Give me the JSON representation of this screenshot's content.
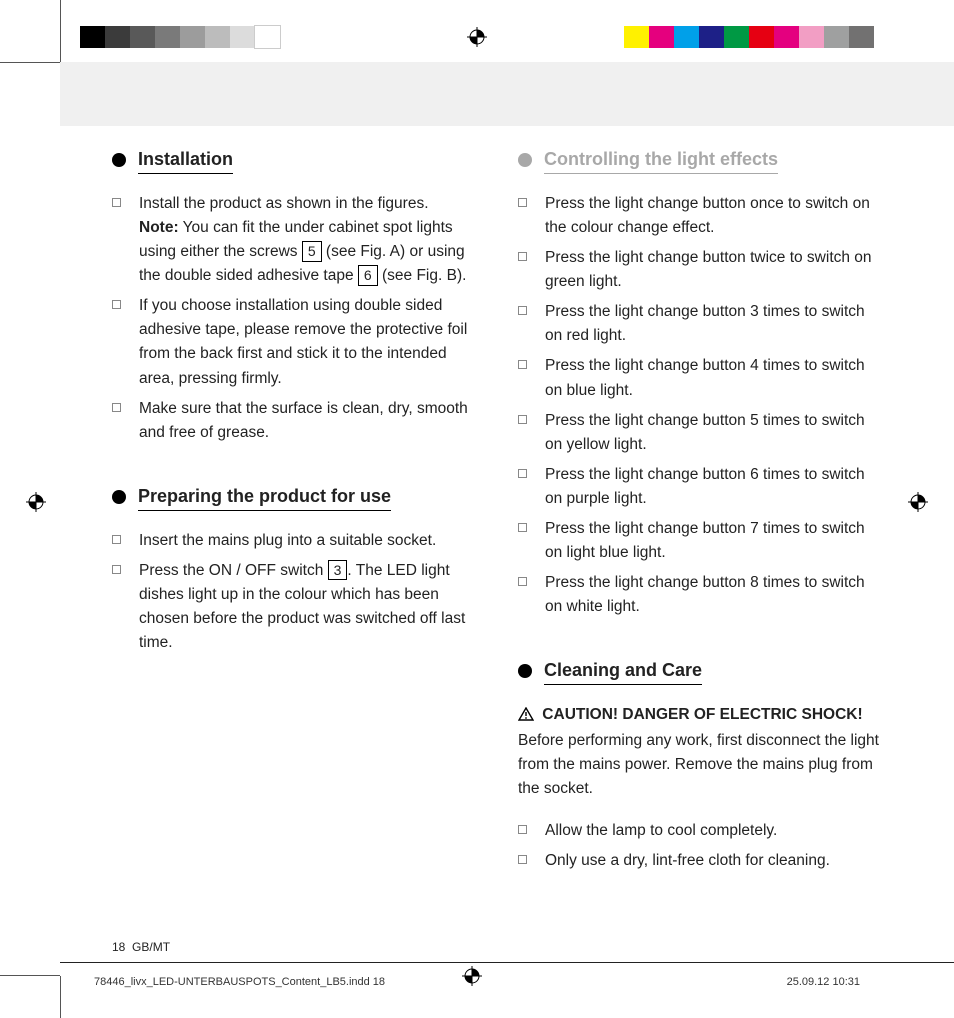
{
  "colorbar": [
    "#000000",
    "#3b3b3b",
    "#595959",
    "#7a7a7a",
    "#9c9c9c",
    "#bcbcbc",
    "#dcdcdc",
    "#ffffff",
    "gap",
    "#fff100",
    "#e5007e",
    "#00a0e9",
    "#1d2087",
    "#009944",
    "#e60012",
    "#e4007f",
    "#f29ec4",
    "#9fa0a0",
    "#727171"
  ],
  "left": {
    "h1": "Installation",
    "items1": [
      {
        "parts": [
          {
            "t": "Install the product as shown in the figures."
          },
          {
            "br": true
          },
          {
            "b": "Note:"
          },
          {
            "t": " You can fit the under cabinet spot lights using either the screws "
          },
          {
            "box": "5"
          },
          {
            "t": " (see Fig. A) or using the double sided adhesive tape "
          },
          {
            "box": "6"
          },
          {
            "t": " (see Fig. B)."
          }
        ]
      },
      {
        "parts": [
          {
            "t": "If you choose installation using double sided adhesive tape, please remove the protective foil from the back first and stick it to the intended area, pressing firmly."
          }
        ]
      },
      {
        "parts": [
          {
            "t": "Make sure that the surface is clean, dry, smooth and free of grease."
          }
        ]
      }
    ],
    "h2": "Preparing the product for use",
    "items2": [
      {
        "parts": [
          {
            "t": "Insert the mains plug into a suitable socket."
          }
        ]
      },
      {
        "parts": [
          {
            "t": "Press the ON / OFF switch "
          },
          {
            "box": "3"
          },
          {
            "t": ". The LED light dishes light up in the colour which has been chosen before the product was switched off last time."
          }
        ]
      }
    ]
  },
  "right": {
    "h1": "Controlling the light effects",
    "items1": [
      {
        "parts": [
          {
            "t": "Press the light change button once to switch on the colour change effect."
          }
        ]
      },
      {
        "parts": [
          {
            "t": "Press the light change button twice to switch on green light."
          }
        ]
      },
      {
        "parts": [
          {
            "t": "Press the light change button 3 times to switch on red light."
          }
        ]
      },
      {
        "parts": [
          {
            "t": "Press the light change button 4 times to switch on blue light."
          }
        ]
      },
      {
        "parts": [
          {
            "t": "Press the light change button 5 times to switch on yellow light."
          }
        ]
      },
      {
        "parts": [
          {
            "t": "Press the light change button 6 times to switch on purple light."
          }
        ]
      },
      {
        "parts": [
          {
            "t": "Press the light change button 7 times to switch on light blue light."
          }
        ]
      },
      {
        "parts": [
          {
            "t": "Press the light change button 8 times to switch on white light."
          }
        ]
      }
    ],
    "h2": "Cleaning and Care",
    "caution_bold": " CAUTION! DANGER OF ELECTRIC SHOCK!",
    "caution_rest": " Before performing any work, first disconnect the light from the mains power. Remove the mains plug from the socket.",
    "items2": [
      {
        "parts": [
          {
            "t": "Allow the lamp to cool completely."
          }
        ]
      },
      {
        "parts": [
          {
            "t": "Only use a dry, lint-free cloth for cleaning."
          }
        ]
      }
    ]
  },
  "footer": {
    "pagenum": "18",
    "lang": "GB/MT",
    "file": "78446_livx_LED-UNTERBAUSPOTS_Content_LB5.indd   18",
    "date": "25.09.12   10:31"
  }
}
